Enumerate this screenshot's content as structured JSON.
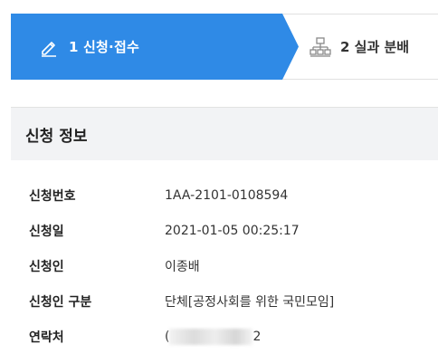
{
  "steps": [
    {
      "number": "1",
      "label": "1 신청·접수",
      "icon": "pencil-icon",
      "active": true
    },
    {
      "number": "2",
      "label": "2 실과 분배",
      "icon": "org-chart-icon",
      "active": false
    }
  ],
  "section": {
    "title": "신청 정보"
  },
  "info": {
    "application_no": {
      "label": "신청번호",
      "value": "1AA-2101-0108594"
    },
    "application_date": {
      "label": "신청일",
      "value": "2021-01-05 00:25:17"
    },
    "applicant": {
      "label": "신청인",
      "value": "이종배"
    },
    "applicant_type": {
      "label": "신청인 구분",
      "value": "단체[공정사회를 위한 국민모임]"
    },
    "contact": {
      "label": "연락처",
      "value_prefix": "(",
      "value_suffix": "2"
    }
  },
  "colors": {
    "accent": "#2f8ae6",
    "header_bg": "#f2f3f5"
  }
}
